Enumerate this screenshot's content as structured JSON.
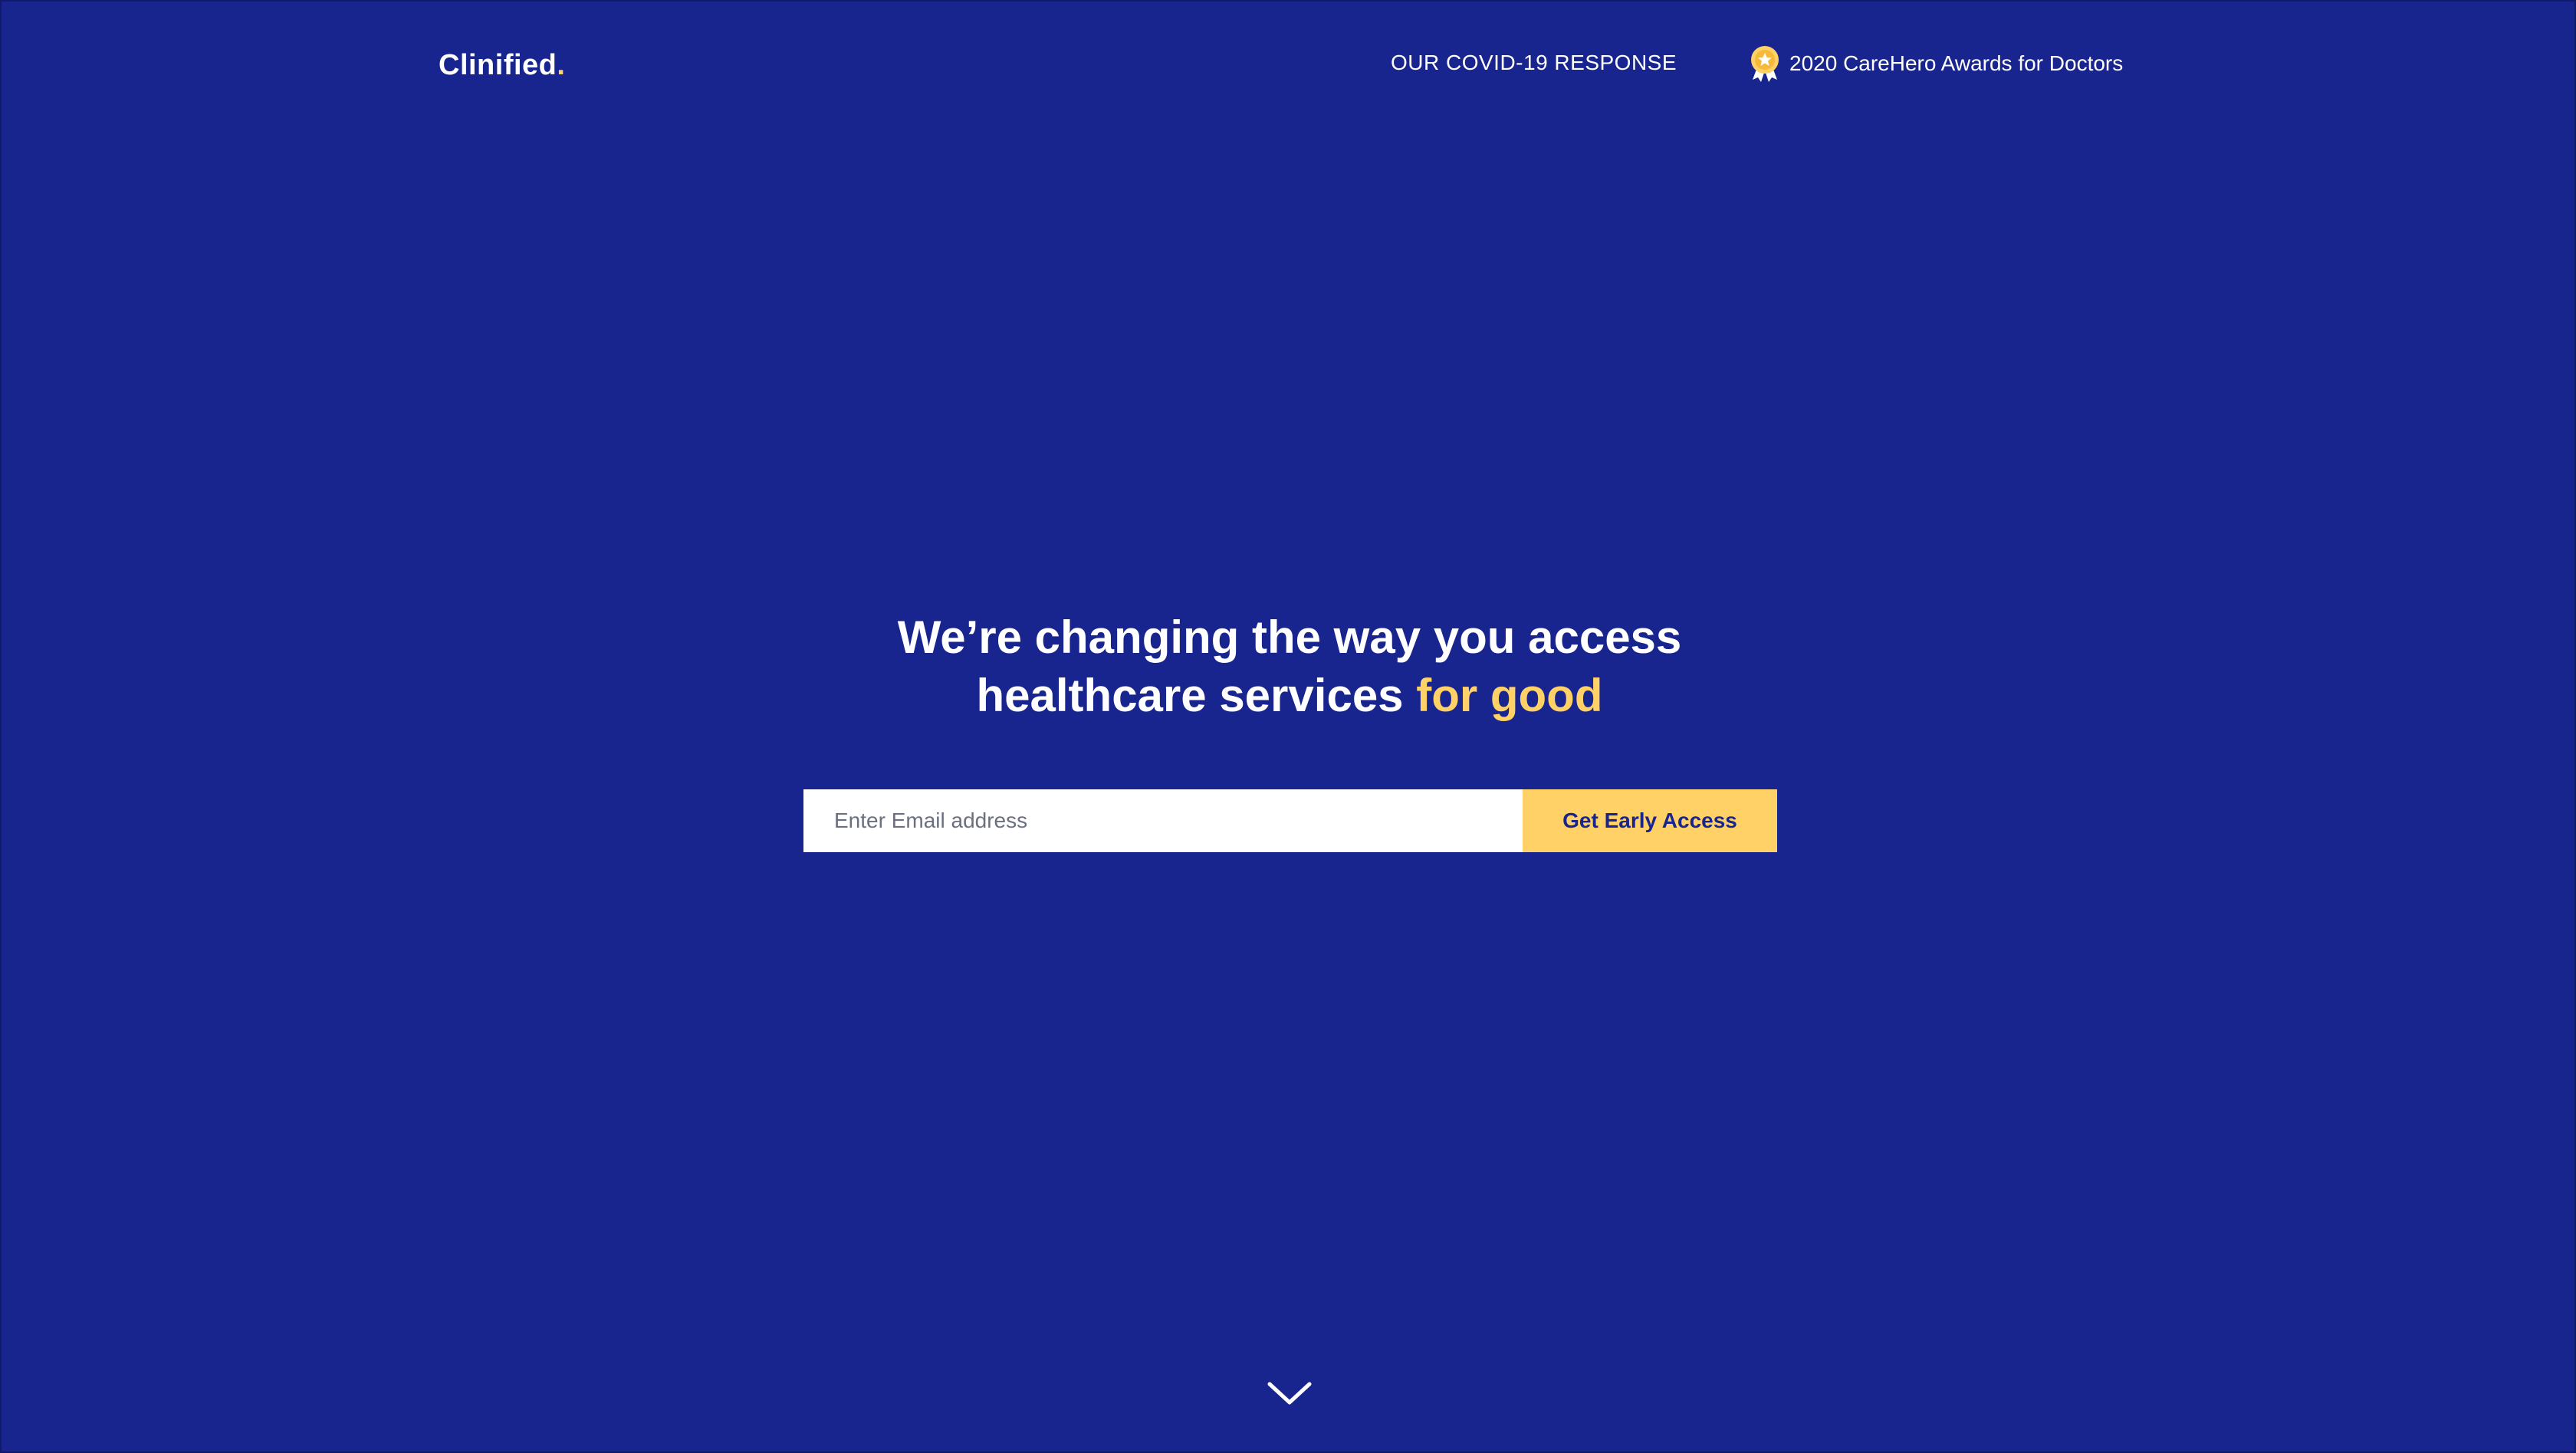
{
  "header": {
    "logo_text": "Clinified",
    "logo_dot": ".",
    "nav_covid": "OUR COVID-19 RESPONSE",
    "nav_award": "2020 CareHero Awards for Doctors",
    "award_icon": "award-medal-icon"
  },
  "hero": {
    "headline_line1": "We’re changing the way you access",
    "headline_line2": "healthcare services ",
    "headline_accent": "for good",
    "email_placeholder": "Enter Email address",
    "cta_label": "Get Early Access",
    "scroll_icon": "chevron-down-icon"
  },
  "colors": {
    "background": "#19258e",
    "accent": "#ffd166",
    "text": "#ffffff",
    "input_bg": "#ffffff"
  }
}
